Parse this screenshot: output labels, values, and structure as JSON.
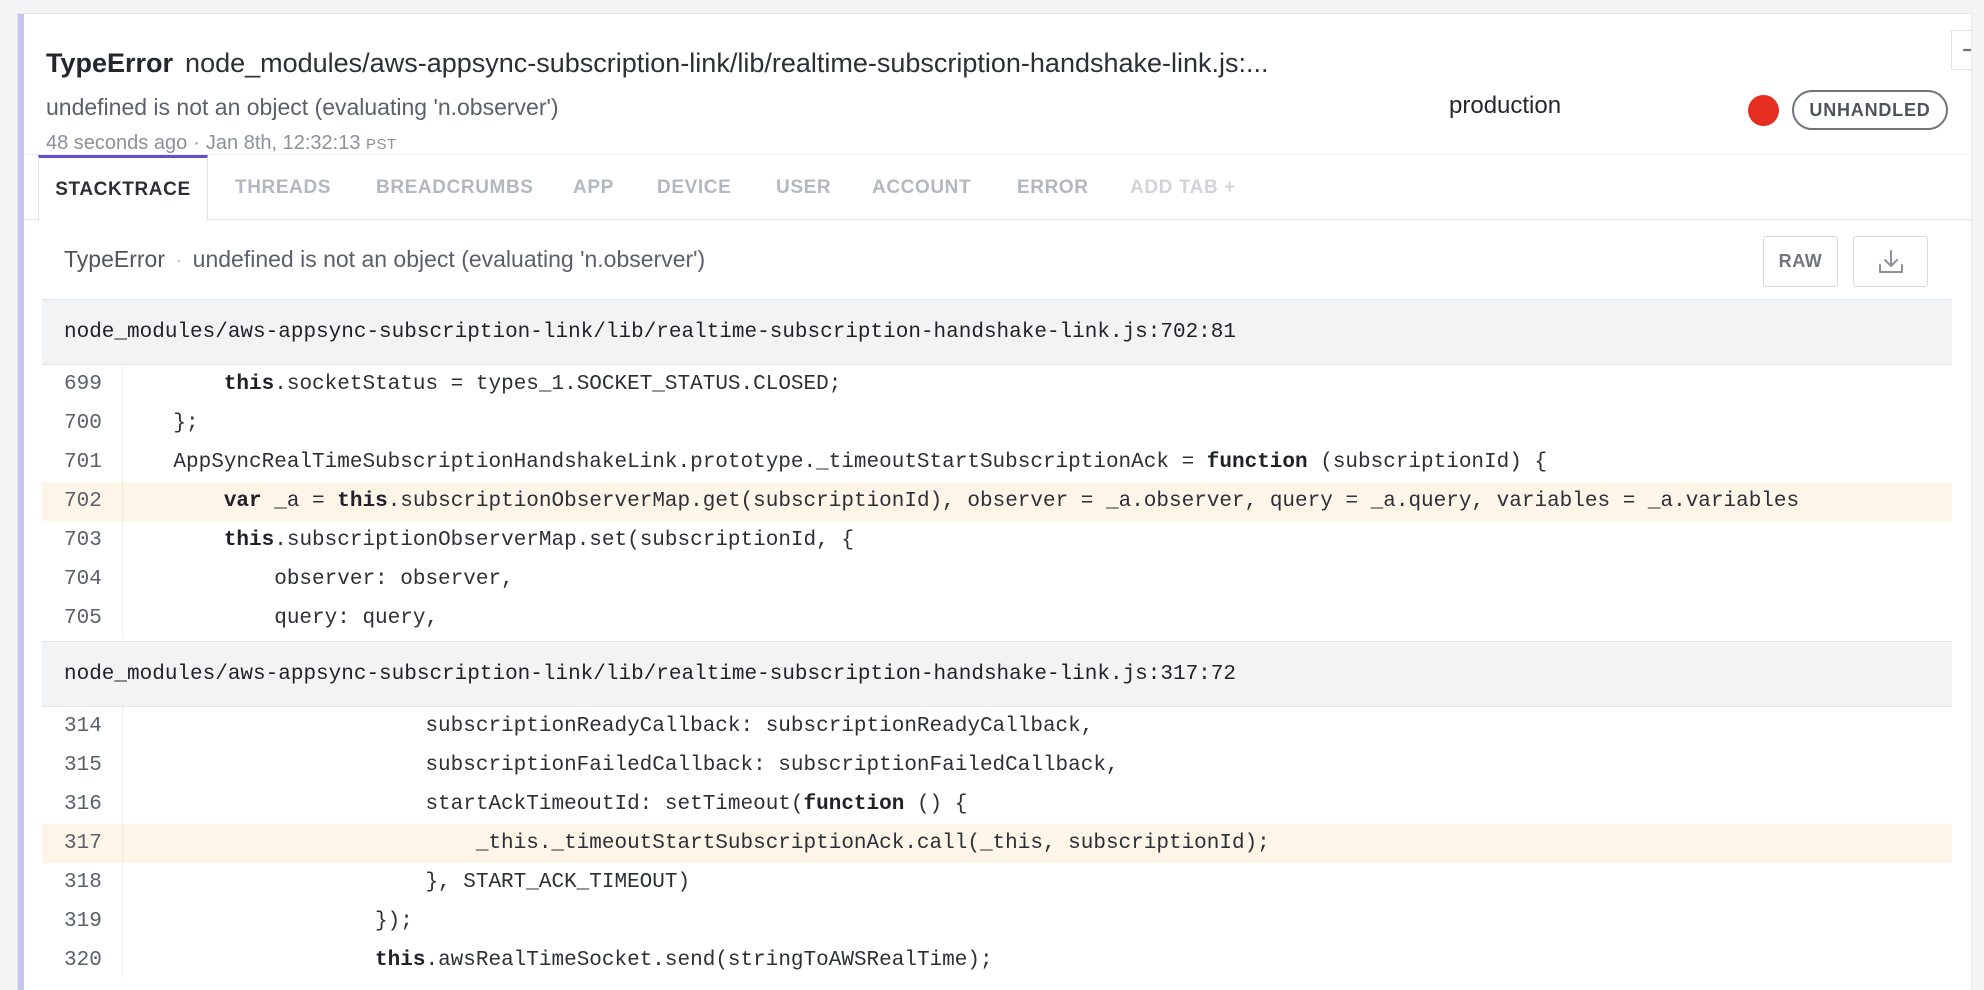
{
  "error": {
    "class": "TypeError",
    "file": "node_modules/aws-appsync-subscription-link/lib/realtime-subscription-handshake-link.js:...",
    "message": "undefined is not an object (evaluating 'n.observer')",
    "relative_time": "48 seconds ago",
    "separator": "·",
    "absolute_time": "Jan 8th, 12:32:13",
    "timezone": "PST",
    "environment": "production",
    "severity_color": "#e62e20",
    "badge": "UNHANDLED"
  },
  "icons": {
    "collapse": "arrow-right-icon",
    "download": "download-icon"
  },
  "tabs": [
    {
      "label": "STACKTRACE",
      "active": true
    },
    {
      "label": "THREADS"
    },
    {
      "label": "BREADCRUMBS"
    },
    {
      "label": "APP"
    },
    {
      "label": "DEVICE"
    },
    {
      "label": "USER"
    },
    {
      "label": "ACCOUNT"
    },
    {
      "label": "ERROR"
    },
    {
      "label": "ADD TAB +"
    }
  ],
  "summary": {
    "class": "TypeError",
    "separator": "·",
    "message": "undefined is not an object (evaluating 'n.observer')",
    "raw_label": "RAW"
  },
  "frames": [
    {
      "file": "node_modules/aws-appsync-subscription-link/lib/realtime-subscription-handshake-link.js:702:81",
      "highlight_line": "702",
      "lines": [
        {
          "n": "699",
          "code": "        <b>this</b>.socketStatus = types_1.SOCKET_STATUS.CLOSED;"
        },
        {
          "n": "700",
          "code": "    };"
        },
        {
          "n": "701",
          "code": "    AppSyncRealTimeSubscriptionHandshakeLink.prototype._timeoutStartSubscriptionAck = <b>function</b> (subscriptionId) {"
        },
        {
          "n": "702",
          "code": "        <b>var</b> _a = <b>this</b>.subscriptionObserverMap.get(subscriptionId), observer = _a.observer, query = _a.query, variables = _a.variables"
        },
        {
          "n": "703",
          "code": "        <b>this</b>.subscriptionObserverMap.set(subscriptionId, {"
        },
        {
          "n": "704",
          "code": "            observer: observer,"
        },
        {
          "n": "705",
          "code": "            query: query,"
        }
      ]
    },
    {
      "file": "node_modules/aws-appsync-subscription-link/lib/realtime-subscription-handshake-link.js:317:72",
      "highlight_line": "317",
      "lines": [
        {
          "n": "314",
          "code": "                        subscriptionReadyCallback: subscriptionReadyCallback,"
        },
        {
          "n": "315",
          "code": "                        subscriptionFailedCallback: subscriptionFailedCallback,"
        },
        {
          "n": "316",
          "code": "                        startAckTimeoutId: setTimeout(<b>function</b> () {"
        },
        {
          "n": "317",
          "code": "                            _this._timeoutStartSubscriptionAck.call(_this, subscriptionId);"
        },
        {
          "n": "318",
          "code": "                        }, START_ACK_TIMEOUT)"
        },
        {
          "n": "319",
          "code": "                    });"
        },
        {
          "n": "320",
          "code": "                    <b>this</b>.awsRealTimeSocket.send(stringToAWSRealTime);"
        }
      ]
    }
  ]
}
